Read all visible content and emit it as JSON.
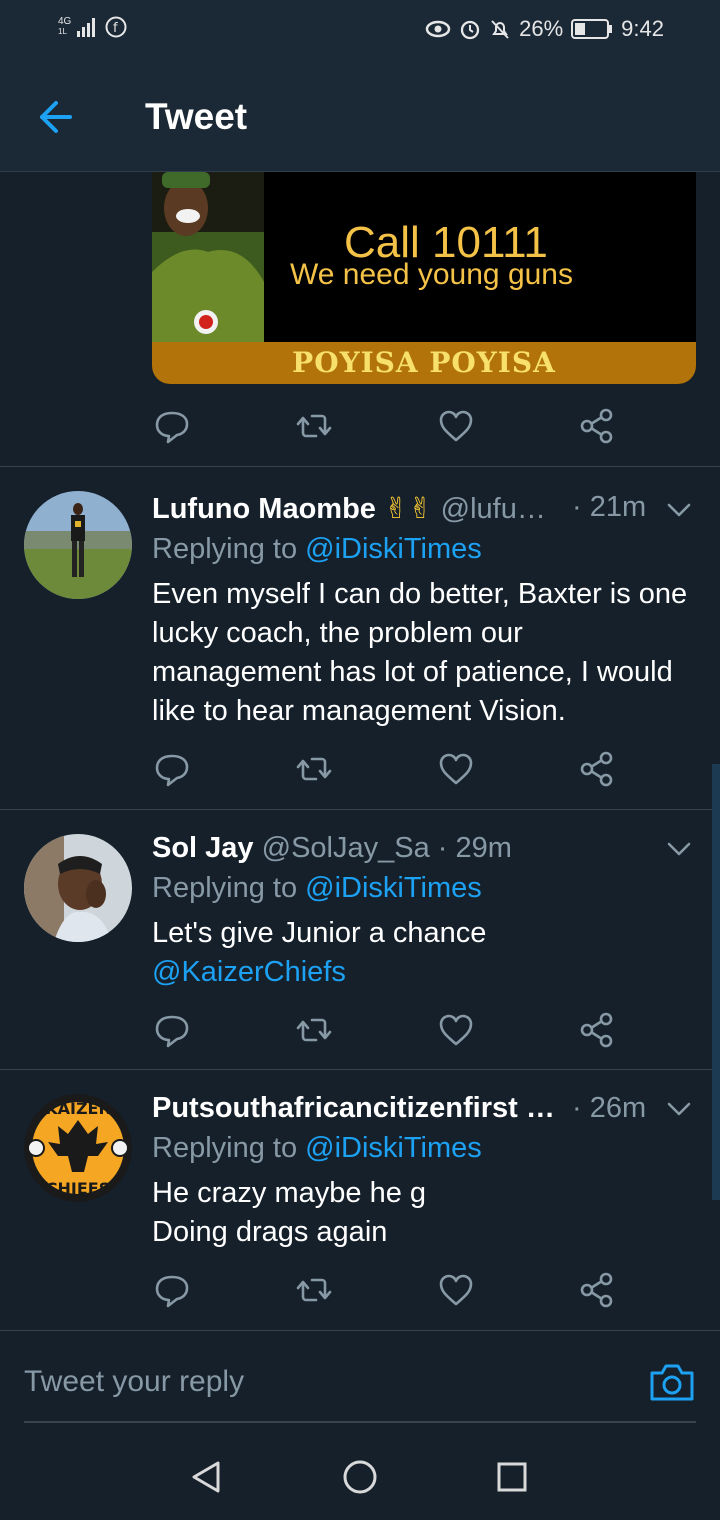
{
  "status_bar": {
    "network": "4G",
    "network_sub": "1L",
    "battery": "26%",
    "time": "9:42"
  },
  "header": {
    "title": "Tweet"
  },
  "media": {
    "line1": "Call 10111",
    "line2": "We need young guns",
    "band": "POYISA POYISA"
  },
  "tweets": [
    {
      "name": "Lufuno Maombe",
      "emoji": "✌✌",
      "handle": "@lufu…",
      "time": "· 21m",
      "replying_prefix": "Replying to ",
      "replying_to": "@iDiskiTimes",
      "body": "Even myself I can do better, Baxter is one lucky coach, the problem our management has lot of patience, I would like to hear management Vision."
    },
    {
      "name": "Sol Jay",
      "handle": "@SolJay_Sa",
      "time": "· 29m",
      "replying_prefix": "Replying to ",
      "replying_to": "@iDiskiTimes",
      "body": "Let's give Junior a chance",
      "body_mention": "@KaizerChiefs"
    },
    {
      "name": "Putsouthafricancitizenfirst …",
      "time": "· 26m",
      "replying_prefix": "Replying to ",
      "replying_to": "@iDiskiTimes",
      "body_line1": "He crazy maybe he g",
      "body_line2": "Doing drags again",
      "avatar_text_top": "KAIZER",
      "avatar_text_bottom": "CHIEFS"
    }
  ],
  "composer": {
    "placeholder": "Tweet your reply"
  },
  "icons": {
    "back": "arrow-left-icon",
    "reply": "reply-icon",
    "retweet": "retweet-icon",
    "like": "heart-icon",
    "share": "share-icon",
    "more": "chevron-down-icon",
    "camera": "camera-icon"
  },
  "colors": {
    "background": "#15202b",
    "accent": "#1da1f2",
    "secondary_text": "#8899a6"
  }
}
